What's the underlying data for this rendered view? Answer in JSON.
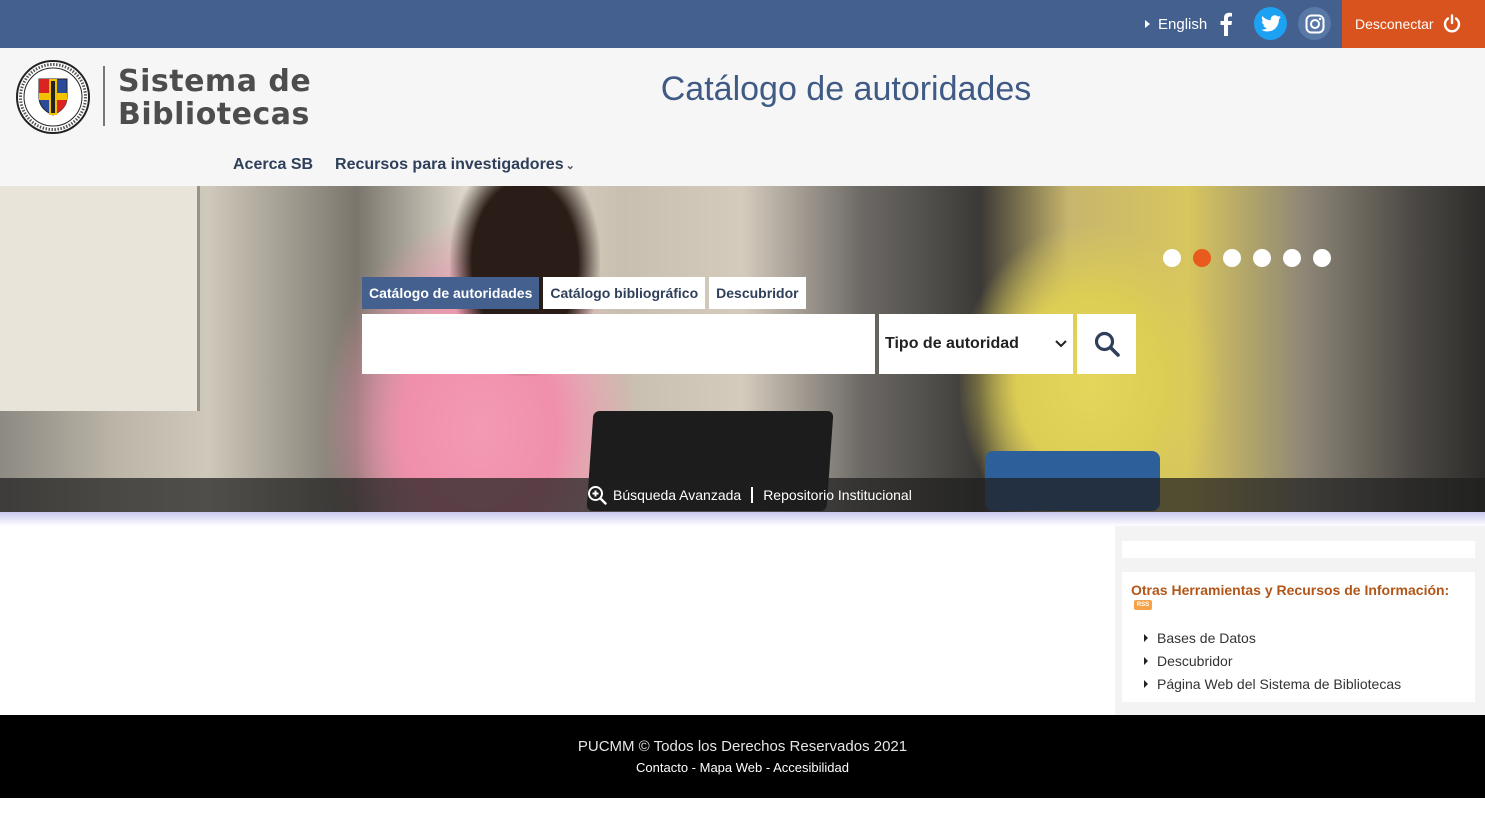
{
  "topbar": {
    "language_label": "English",
    "social": [
      "facebook-icon",
      "twitter-icon",
      "instagram-icon"
    ],
    "logout_label": "Desconectar"
  },
  "header": {
    "brand_line1": "Sistema de",
    "brand_line2": "Bibliotecas",
    "page_title": "Catálogo de autoridades",
    "nav": {
      "about": "Acerca SB",
      "resources": "Recursos para investigadores"
    }
  },
  "search": {
    "tabs": [
      {
        "label": "Catálogo de autoridades",
        "active": true
      },
      {
        "label": "Catálogo bibliográfico",
        "active": false
      },
      {
        "label": "Descubridor",
        "active": false
      }
    ],
    "query_value": "",
    "authority_type_selected": "Tipo de autoridad",
    "advanced_label": "Búsqueda Avanzada",
    "repository_label": "Repositorio Institucional"
  },
  "carousel": {
    "slide_count": 6,
    "active_index": 1
  },
  "sidebar": {
    "title": "Otras Herramientas y Recursos de Información:",
    "items": [
      "Bases de Datos",
      "Descubridor",
      "Página Web del Sistema de Bibliotecas"
    ]
  },
  "footer": {
    "copyright": "PUCMM © Todos los Derechos Reservados 2021",
    "link_contact": "Contacto",
    "link_sitemap": "Mapa Web",
    "link_accessibility": "Accesibilidad",
    "separator": " - "
  },
  "colors": {
    "primary": "#43608e",
    "accent": "#d9531e",
    "carousel_active": "#e95a1d",
    "sidebar_title": "#b15618"
  }
}
